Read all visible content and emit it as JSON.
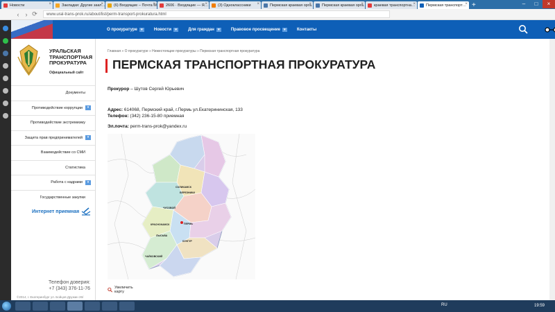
{
  "browser": {
    "tabs": [
      {
        "label": "Новости",
        "color": "#e23b3b",
        "active": false
      },
      {
        "label": "Закладки: Другие закл…",
        "color": "#f5a623",
        "active": false
      },
      {
        "label": "(6) Входящие – Почта М…",
        "color": "#e9a50a",
        "active": false
      },
      {
        "label": "2606 · Входящие — Я…",
        "color": "#e23b3b",
        "active": false
      },
      {
        "label": "(3) Одноклассники",
        "color": "#f07d00",
        "active": false
      },
      {
        "label": "Пермская краевая орга…",
        "color": "#4a76a8",
        "active": false
      },
      {
        "label": "Пермская краевая орга…",
        "color": "#4a76a8",
        "active": false
      },
      {
        "label": "краевая транспортна…",
        "color": "#e23b3b",
        "active": false
      },
      {
        "label": "Пермская транспорт…",
        "color": "#0e5fb7",
        "active": true
      }
    ],
    "url": "www.ural-trans-prok.ru/about/list/perm-transport-prokuratura.html"
  },
  "header": {
    "nav": [
      {
        "label": "О прокуратуре",
        "dropdown": true
      },
      {
        "label": "Новости",
        "dropdown": true
      },
      {
        "label": "Для граждан",
        "dropdown": true
      },
      {
        "label": "Правовое просвещение",
        "dropdown": true
      },
      {
        "label": "Контакты",
        "dropdown": false
      }
    ],
    "brand_color": "#0e5fb7"
  },
  "sidebar": {
    "org_line1": "УРАЛЬСКАЯ",
    "org_line2": "ТРАНСПОРТНАЯ",
    "org_line3": "ПРОКУРАТУРА",
    "org_sub": "Официальный сайт",
    "menu": [
      {
        "label": "Документы",
        "dropdown": false
      },
      {
        "label": "Противодействие коррупции",
        "dropdown": true
      },
      {
        "label": "Противодействие экстремизму",
        "dropdown": false
      },
      {
        "label": "Защита прав предпринимателей",
        "dropdown": true
      },
      {
        "label": "Взаимодействие со СМИ",
        "dropdown": false
      },
      {
        "label": "Статистика",
        "dropdown": false
      },
      {
        "label": "Работа с кадрами",
        "dropdown": true
      },
      {
        "label": "Государственные закупки",
        "dropdown": false
      }
    ],
    "reception": "Интернет приемная",
    "hotline_label": "Телефон доверия:",
    "hotline_number": "+7 (343) 376-11-76",
    "footer_line1": "©2014, г. Екатеринбург ул. Бойцов Дружин 26/",
    "footer_line2": "ул. Шефченко, 7"
  },
  "main": {
    "breadcrumbs": "Главная » О прокуратуре » Нижестоящие прокуратуры » Пермская транспортная прокуратура",
    "title": "ПЕРМСКАЯ ТРАНСПОРТНАЯ ПРОКУРАТУРА",
    "prosecutor_label": "Прокурор",
    "prosecutor_value": " – Шутов Сергей Юрьевич",
    "address_label": "Адрес:",
    "address_value": " 614068, Пермский край, г.Пермь ул.Екатерининская, 133",
    "phone_label": "Телефон:",
    "phone_value": " (342) 236-15-80 приемная",
    "email_label": "Эл.почта:",
    "email_value": " perm-trans-prok@yandex.ru",
    "map_labels": [
      "СОЛИКАМСК",
      "БЕРЕЗНИКИ",
      "КРАСНОКАМСК",
      "ПЕРМЬ",
      "КУНГУР",
      "ЧАЙКОВСКИЙ",
      "ЧУСОВОЙ",
      "ЛЫСЬВА"
    ],
    "zoom_link": "Увеличить карту"
  },
  "taskbar": {
    "lang": "RU",
    "time": "19:59"
  }
}
